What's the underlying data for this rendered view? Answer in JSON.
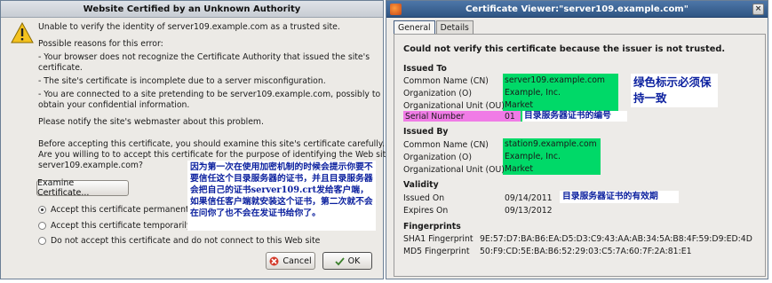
{
  "left_dialog": {
    "title": "Website Certified by an Unknown Authority",
    "message": "Unable to verify the identity of server109.example.com as a trusted site.",
    "reasons_heading": "Possible reasons for this error:",
    "reason_1a": "- Your browser does not recognize the Certificate Authority that issued the site's",
    "reason_1b": "certificate.",
    "reason_2": "- The site's certificate is incomplete due to a server misconfiguration.",
    "reason_3a": "- You are connected to a site pretending to be server109.example.com, possibly to",
    "reason_3b": "obtain your confidential information.",
    "notify": "Please notify the site's webmaster about this problem.",
    "before_a": "Before accepting this certificate, you should examine this site's certificate carefully.",
    "before_b": "Are you willing to to accept this certificate for the purpose of identifying the Web site",
    "before_c": "server109.example.com?",
    "examine_button": "Examine Certificate...",
    "option_permanent": "Accept this certificate permanently",
    "option_temporary": "Accept this certificate temporarily fo",
    "option_reject": "Do not accept this certificate and do not connect to this Web site",
    "cancel_button": "Cancel",
    "ok_button": "OK",
    "annotation": "因为第一次在使用加密机制的时候会提示你要不要信任这个目录服务器的证书，并且目录服务器会把自己的证书server109.crt发给客户端，如果信任客户端就安装这个证书，第二次就不会在问你了也不会在发证书给你了。"
  },
  "right_dialog": {
    "title": "Certificate Viewer:\"server109.example.com\"",
    "tabs": [
      "General",
      "Details"
    ],
    "warning": "Could not verify this certificate because the issuer is not trusted.",
    "issued_to": {
      "heading": "Issued To",
      "cn_label": "Common Name (CN)",
      "cn_value": "server109.example.com",
      "o_label": "Organization (O)",
      "o_value": "Example, Inc.",
      "ou_label": "Organizational Unit (OU)",
      "ou_value": "Market",
      "serial_label": "Serial Number",
      "serial_value": "01"
    },
    "issued_by": {
      "heading": "Issued By",
      "cn_label": "Common Name (CN)",
      "cn_value": "station9.example.com",
      "o_label": "Organization (O)",
      "o_value": "Example, Inc.",
      "ou_label": "Organizational Unit (OU)",
      "ou_value": "Market"
    },
    "validity": {
      "heading": "Validity",
      "issued_label": "Issued On",
      "issued_value": "09/14/2011",
      "expires_label": "Expires On",
      "expires_value": "09/13/2012"
    },
    "fingerprints": {
      "heading": "Fingerprints",
      "sha1_label": "SHA1 Fingerprint",
      "sha1_value": "9E:57:D7:BA:B6:EA:D5:D3:C9:43:AA:AB:34:5A:B8:4F:59:D9:ED:4D",
      "md5_label": "MD5 Fingerprint",
      "md5_value": "50:F9:CD:5E:BA:B6:52:29:03:C5:7A:60:7F:2A:81:E1"
    },
    "note_green": "绿色标示必须保持一致",
    "note_serial": "目录服务器证书的编号",
    "note_validity": "目录服务器证书的有效期"
  },
  "colors": {
    "highlight_green": "#00d968",
    "highlight_pink": "#f07be6",
    "annotation_text": "#0a1f9e"
  }
}
